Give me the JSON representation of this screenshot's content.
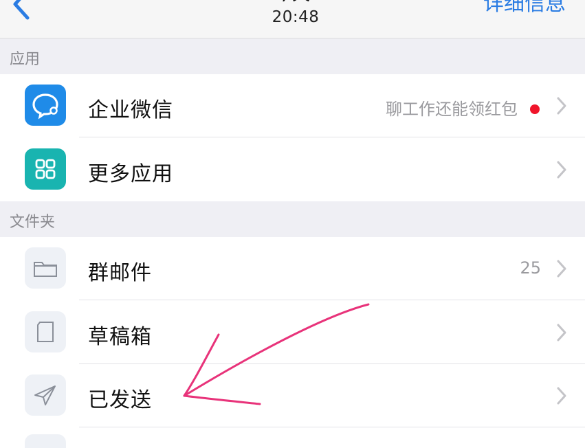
{
  "navbar": {
    "back_icon": "chevron-left-icon",
    "title_partial": "今天",
    "time": "20:48",
    "detail_link": "详细信息"
  },
  "sections": {
    "apps_header": "应用",
    "folders_header": "文件夹"
  },
  "apps": [
    {
      "label": "企业微信",
      "detail": "聊工作还能领红包",
      "icon": "wecom-icon",
      "color": "#1f8be8",
      "has_dot": true
    },
    {
      "label": "更多应用",
      "icon": "apps-grid-icon",
      "color": "#19b4b0"
    }
  ],
  "folders": [
    {
      "label": "群邮件",
      "count": "25",
      "icon": "folder-icon"
    },
    {
      "label": "草稿箱",
      "icon": "draft-icon"
    },
    {
      "label": "已发送",
      "icon": "send-icon"
    }
  ],
  "colors": {
    "accent": "#2a7ce3",
    "annotation_arrow": "#e8337a",
    "red_dot": "#f0142a"
  }
}
